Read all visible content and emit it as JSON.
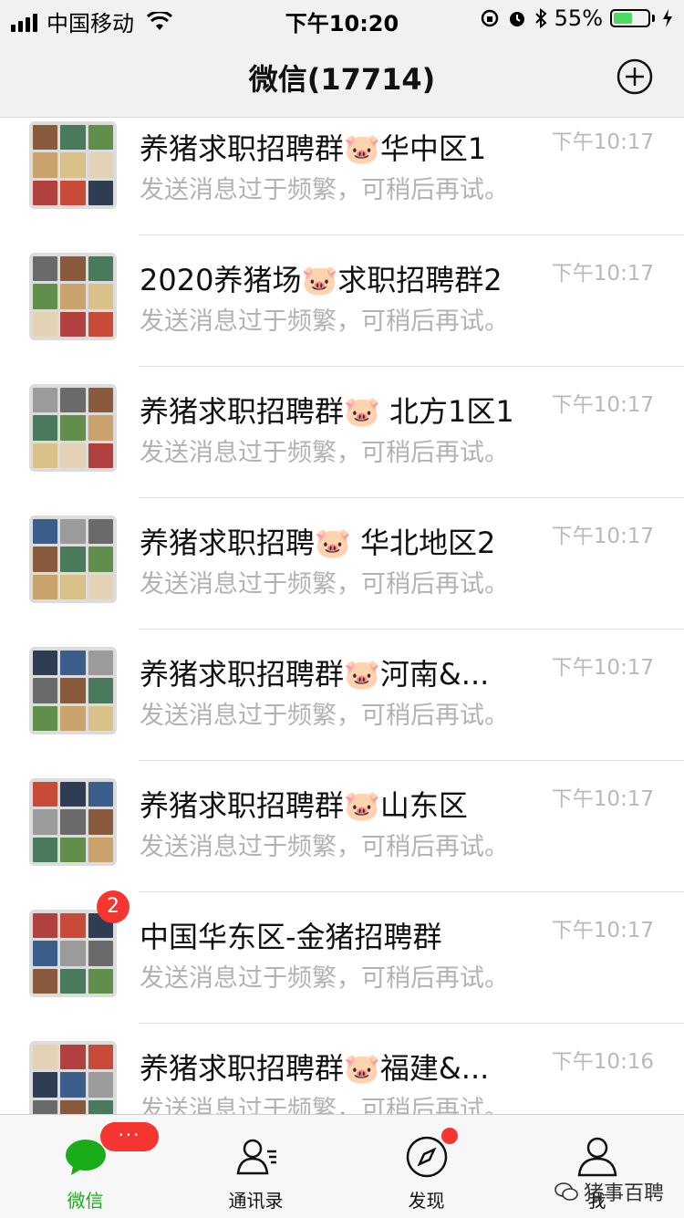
{
  "status_bar": {
    "carrier": "中国移动",
    "time": "下午10:20",
    "battery": "55%",
    "battery_level": 0.55
  },
  "header": {
    "title": "微信(17714)",
    "add_icon": "plus-circle-icon"
  },
  "chats": [
    {
      "name": "养猪求职招聘群🐷华中区1",
      "message": "发送消息过于频繁，可稍后再试。",
      "time": "下午10:17",
      "badge": ""
    },
    {
      "name": "2020养猪场🐷求职招聘群2",
      "message": "发送消息过于频繁，可稍后再试。",
      "time": "下午10:17",
      "badge": ""
    },
    {
      "name": "养猪求职招聘群🐷 北方1区1",
      "message": "发送消息过于频繁，可稍后再试。",
      "time": "下午10:17",
      "badge": ""
    },
    {
      "name": "养猪求职招聘🐷 华北地区2",
      "message": "发送消息过于频繁，可稍后再试。",
      "time": "下午10:17",
      "badge": ""
    },
    {
      "name": "养猪求职招聘群🐷河南&...",
      "message": "发送消息过于频繁，可稍后再试。",
      "time": "下午10:17",
      "badge": ""
    },
    {
      "name": "养猪求职招聘群🐷山东区",
      "message": "发送消息过于频繁，可稍后再试。",
      "time": "下午10:17",
      "badge": ""
    },
    {
      "name": "中国华东区-金猪招聘群",
      "message": "发送消息过于频繁，可稍后再试。",
      "time": "下午10:17",
      "badge": "2"
    },
    {
      "name": "养猪求职招聘群🐷福建&...",
      "message": "发送消息过于频繁，可稍后再试。",
      "time": "下午10:16",
      "badge": ""
    }
  ],
  "tabs": [
    {
      "label": "微信",
      "icon": "chat-bubble-icon",
      "active": true,
      "badge": "···"
    },
    {
      "label": "通讯录",
      "icon": "contacts-icon",
      "active": false,
      "badge": ""
    },
    {
      "label": "发现",
      "icon": "compass-icon",
      "active": false,
      "badge": "dot"
    },
    {
      "label": "我",
      "icon": "person-icon",
      "active": false,
      "badge": ""
    }
  ],
  "watermark": "猪事百聘",
  "colors": {
    "accent_green": "#1aad19",
    "badge_red": "#f43530",
    "header_bg": "#f1f1f1"
  }
}
